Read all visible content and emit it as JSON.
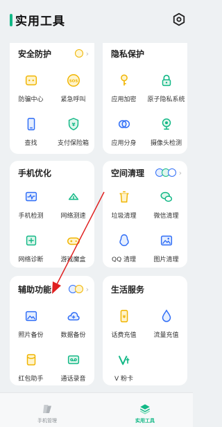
{
  "header": {
    "title": "实用工具"
  },
  "cards": {
    "security": {
      "title": "安全防护",
      "items": [
        "防骗中心",
        "紧急呼叫",
        "查找",
        "支付保险箱"
      ]
    },
    "privacy": {
      "title": "隐私保护",
      "items": [
        "应用加密",
        "原子隐私系统",
        "应用分身",
        "摄像头检测"
      ]
    },
    "phone": {
      "title": "手机优化",
      "items": [
        "手机检测",
        "网络测速",
        "网络诊断",
        "游戏魔盒"
      ]
    },
    "space": {
      "title": "空间清理",
      "items": [
        "垃圾清理",
        "微信清理",
        "QQ 清理",
        "图片清理"
      ]
    },
    "assist": {
      "title": "辅助功能",
      "items": [
        "照片备份",
        "数据备份",
        "红包助手",
        "通话录音"
      ]
    },
    "life": {
      "title": "生活服务",
      "items": [
        "话费充值",
        "流量充值",
        "V 粉卡"
      ]
    }
  },
  "bottom_nav": {
    "manage": "手机管理",
    "tools": "实用工具"
  },
  "colors": {
    "accent": "#12b886",
    "red_arrow": "#e02020",
    "badge_yellow": "#f0b400",
    "badge_blue": "#2f6df6"
  }
}
